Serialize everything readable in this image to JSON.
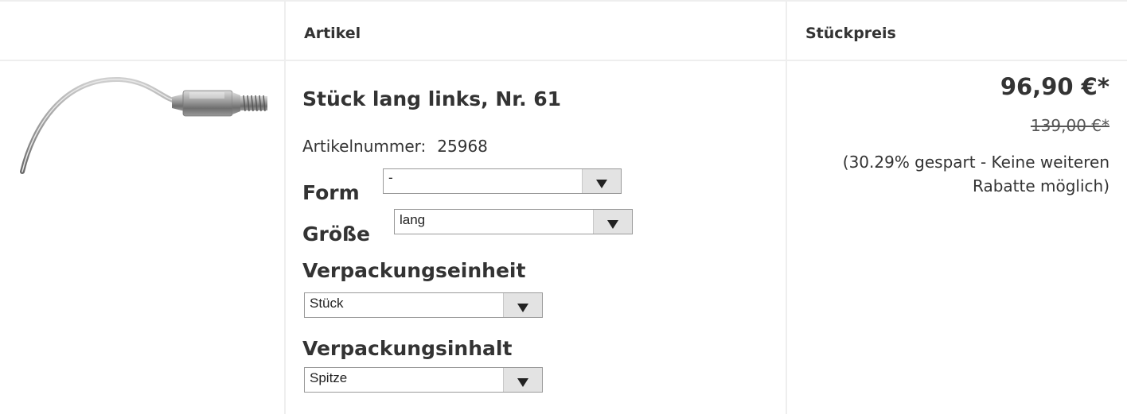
{
  "table": {
    "headers": {
      "artikel": "Artikel",
      "stueckpreis": "Stückpreis"
    }
  },
  "product": {
    "image_alt": "scaler-tip-icon",
    "title": "Stück lang links, Nr. 61",
    "article_number_label": "Artikelnummer:",
    "article_number": "25968",
    "options": [
      {
        "label": "Form",
        "value": "-"
      },
      {
        "label": "Größe",
        "value": "lang"
      },
      {
        "label": "Verpackungseinheit",
        "value": "Stück"
      },
      {
        "label": "Verpackungsinhalt",
        "value": "Spitze"
      }
    ]
  },
  "price": {
    "current": "96,90 €*",
    "original": "139,00 €*",
    "savings_note": "(30.29% gespart - Keine weiteren Rabatte möglich)"
  },
  "colors": {
    "divider": "#eeeeee",
    "text": "#333333",
    "select_arrow_bg": "#e3e3e3"
  }
}
